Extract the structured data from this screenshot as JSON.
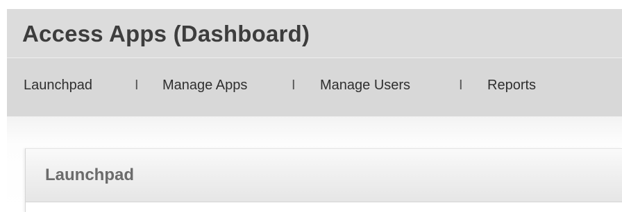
{
  "header": {
    "title": "Access Apps (Dashboard)"
  },
  "nav": {
    "items": [
      {
        "label": "Launchpad"
      },
      {
        "label": "Manage Apps"
      },
      {
        "label": "Manage Users"
      },
      {
        "label": "Reports"
      }
    ],
    "separator": "I"
  },
  "panel": {
    "title": "Launchpad"
  },
  "colors": {
    "header_bg": "#dcdcdc",
    "title_text": "#3d3d3d",
    "panel_title_text": "#6b6b6b"
  }
}
